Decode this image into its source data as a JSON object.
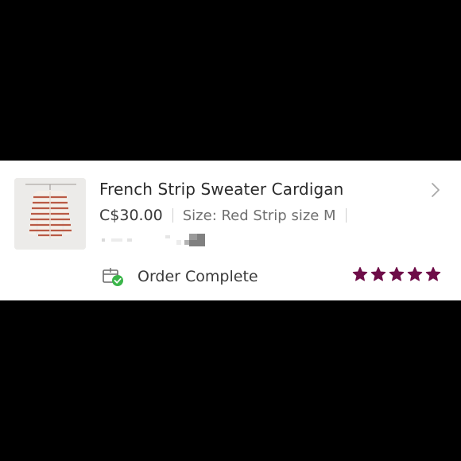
{
  "order": {
    "product_name": "French Strip Sweater Cardigan",
    "price": "C$30.00",
    "size_text": "Size: Red Strip size M",
    "status_text": "Order Complete",
    "rating": 5,
    "rating_max": 5
  },
  "icons": {
    "chevron": "chevron-right-icon",
    "status": "order-complete-icon",
    "star": "star-icon"
  },
  "colors": {
    "background": "#000000",
    "card": "#ffffff",
    "star": "#6e0d48",
    "check": "#3bb54a"
  }
}
